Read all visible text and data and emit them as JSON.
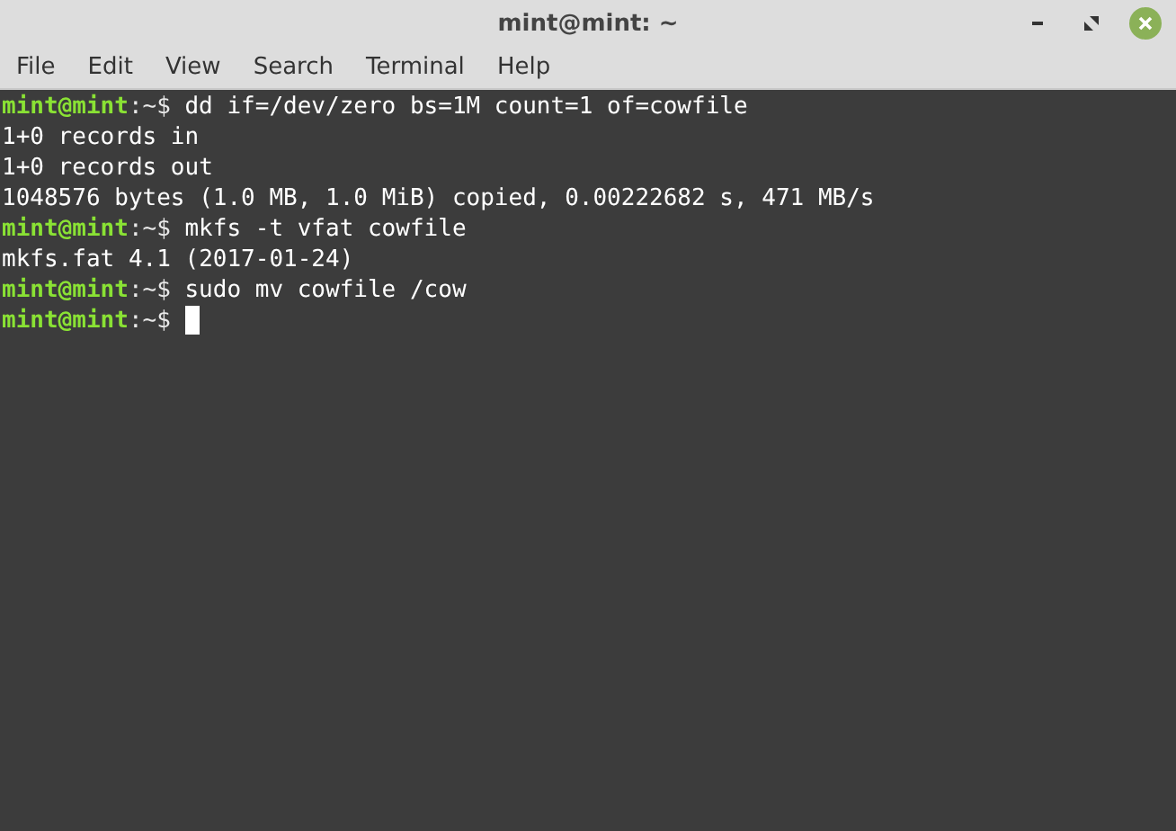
{
  "window": {
    "title": "mint@mint: ~"
  },
  "menu": [
    "File",
    "Edit",
    "View",
    "Search",
    "Terminal",
    "Help"
  ],
  "terminal": {
    "cursor": true,
    "lines": [
      {
        "kind": "prompt",
        "user": "mint@mint",
        "path": ":~$",
        "command": "dd if=/dev/zero bs=1M count=1 of=cowfile"
      },
      {
        "kind": "output",
        "text": "1+0 records in"
      },
      {
        "kind": "output",
        "text": "1+0 records out"
      },
      {
        "kind": "output",
        "text": "1048576 bytes (1.0 MB, 1.0 MiB) copied, 0.00222682 s, 471 MB/s"
      },
      {
        "kind": "prompt",
        "user": "mint@mint",
        "path": ":~$",
        "command": "mkfs -t vfat cowfile"
      },
      {
        "kind": "output",
        "text": "mkfs.fat 4.1 (2017-01-24)"
      },
      {
        "kind": "prompt",
        "user": "mint@mint",
        "path": ":~$",
        "command": "sudo mv cowfile /cow"
      },
      {
        "kind": "prompt",
        "user": "mint@mint",
        "path": ":~$"
      }
    ]
  }
}
